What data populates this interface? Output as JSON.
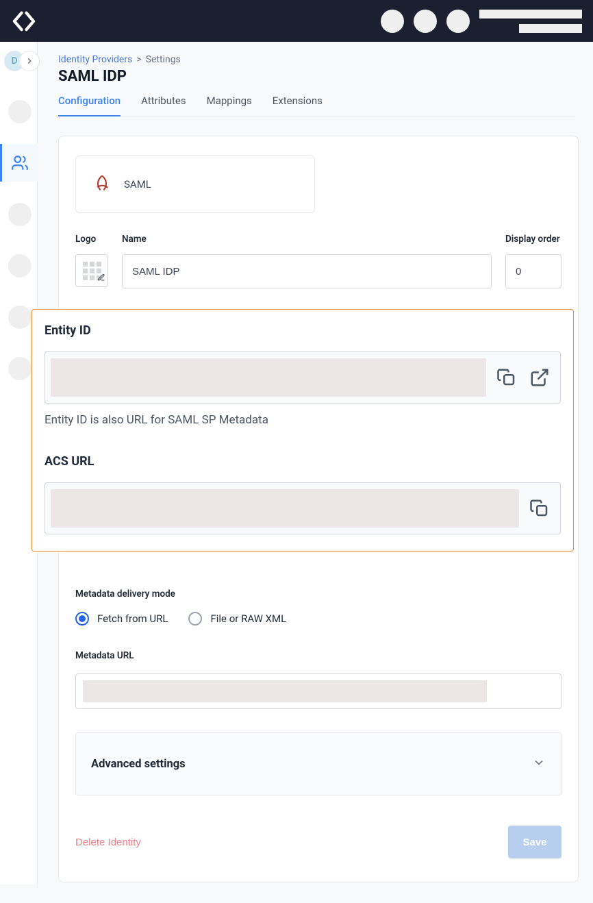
{
  "rail": {
    "badge_letter": "D"
  },
  "breadcrumb": {
    "parent": "Identity Providers",
    "sep": ">",
    "current": "Settings"
  },
  "page": {
    "title": "SAML IDP"
  },
  "tabs": [
    "Configuration",
    "Attributes",
    "Mappings",
    "Extensions"
  ],
  "active_tab": 0,
  "preview": {
    "protocol": "SAML"
  },
  "form": {
    "logo_label": "Logo",
    "name_label": "Name",
    "name_value": "SAML IDP",
    "display_order_label": "Display order",
    "display_order_value": "0"
  },
  "highlight": {
    "entity_id_label": "Entity ID",
    "entity_id_help": "Entity ID is also URL for SAML SP Metadata",
    "acs_url_label": "ACS URL"
  },
  "metadata": {
    "mode_label": "Metadata delivery mode",
    "options": [
      "Fetch from URL",
      "File or RAW XML"
    ],
    "selected": 0,
    "url_label": "Metadata URL"
  },
  "advanced_label": "Advanced settings",
  "actions": {
    "delete": "Delete Identity",
    "save": "Save"
  }
}
